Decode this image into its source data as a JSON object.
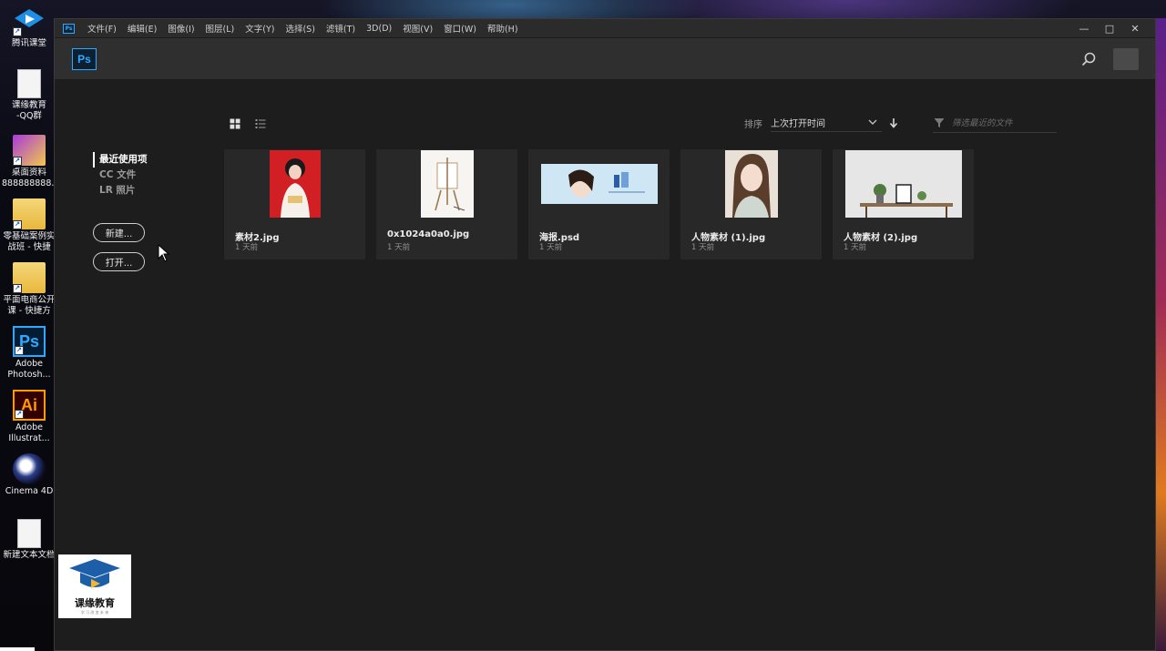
{
  "desktop": {
    "icons": [
      {
        "label": "腾讯课堂",
        "icon": "tencent-classroom-icon"
      },
      {
        "label": "课缘教育\n-QQ群",
        "icon": "text-document-icon"
      },
      {
        "label": "桌面资料\n888888888...",
        "icon": "folder-icon"
      },
      {
        "label": "零基础案例实\n战班 - 快捷",
        "icon": "folder-icon"
      },
      {
        "label": "平面电商公开\n课 - 快捷方",
        "icon": "folder-icon"
      },
      {
        "label": "Adobe\nPhotosh...",
        "icon": "photoshop-icon",
        "glyph": "Ps"
      },
      {
        "label": "Adobe\nIllustrat...",
        "icon": "illustrator-icon",
        "glyph": "Ai"
      },
      {
        "label": "Cinema 4D",
        "icon": "cinema4d-icon"
      },
      {
        "label": "新建文本文档",
        "icon": "text-document-icon"
      }
    ],
    "watermark": {
      "text": "课缘教育",
      "subtext": "学 习 改 变 未 来"
    }
  },
  "app": {
    "logo": "Ps",
    "menu": [
      "文件(F)",
      "编辑(E)",
      "图像(I)",
      "图层(L)",
      "文字(Y)",
      "选择(S)",
      "滤镜(T)",
      "3D(D)",
      "视图(V)",
      "窗口(W)",
      "帮助(H)"
    ],
    "window_controls": {
      "minimize": "—",
      "maximize": "□",
      "close": "✕"
    }
  },
  "sidebar": {
    "items": [
      {
        "label": "最近使用项",
        "active": true
      },
      {
        "label": "CC 文件",
        "active": false
      },
      {
        "label": "LR 照片",
        "active": false
      }
    ],
    "new_button": "新建...",
    "open_button": "打开..."
  },
  "toolbar": {
    "sort_label": "排序",
    "sort_value": "上次打开时间",
    "filter_placeholder": "筛选最近的文件"
  },
  "files": [
    {
      "name": "素材2.jpg",
      "time": "1 天前"
    },
    {
      "name": "0x1024a0a0.jpg",
      "time": "1 天前"
    },
    {
      "name": "海报.psd",
      "time": "1 天前"
    },
    {
      "name": "人物素材 (1).jpg",
      "time": "1 天前"
    },
    {
      "name": "人物素材 (2).jpg",
      "time": "1 天前"
    }
  ],
  "colors": {
    "accent": "#31a8ff",
    "panel": "#1e1e1e",
    "card": "#282828"
  }
}
